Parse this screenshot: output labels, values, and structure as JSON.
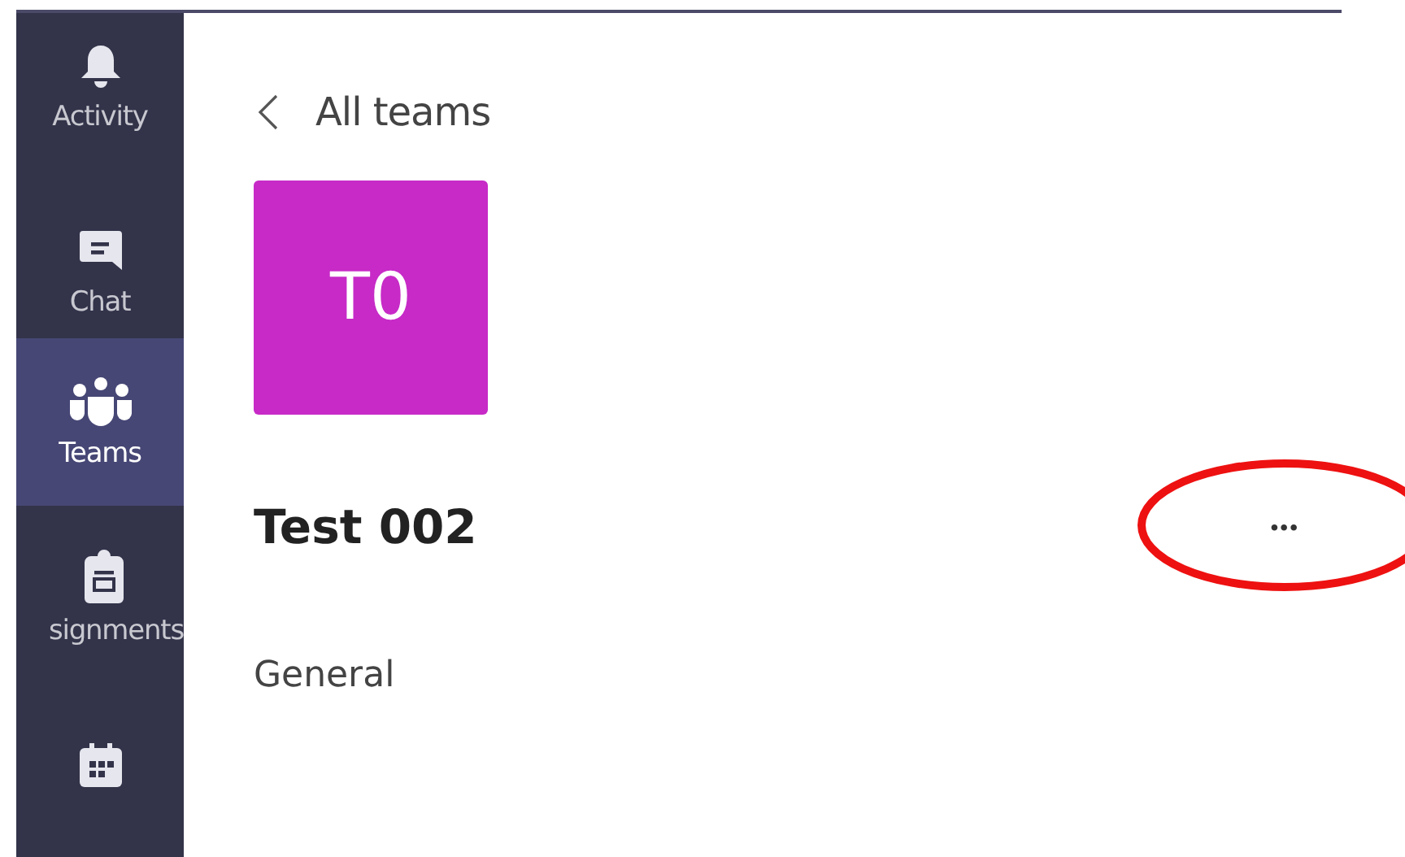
{
  "sidebar": {
    "items": [
      {
        "label": "Activity",
        "selected": false
      },
      {
        "label": "Chat",
        "selected": false
      },
      {
        "label": "Teams",
        "selected": true
      },
      {
        "label": "signments",
        "selected": false
      },
      {
        "selected": false
      }
    ]
  },
  "header": {
    "back_label": "All teams"
  },
  "team": {
    "initials": "T0",
    "color": "#c72ac7",
    "name": "Test 002",
    "more": "•••",
    "highlighted": true
  },
  "channels": [
    {
      "name": "General"
    }
  ]
}
